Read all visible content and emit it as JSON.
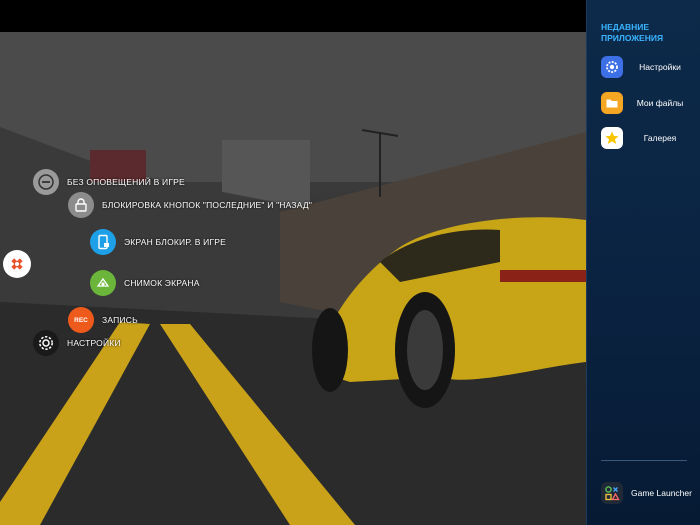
{
  "game_menu": {
    "items": [
      {
        "label": "БЕЗ ОПОВЕЩЕНИЙ В ИГРЕ",
        "icon": "minus-circle-icon"
      },
      {
        "label": "БЛОКИРОВКА КНОПОК \"ПОСЛЕДНИЕ\" И \"НАЗАД\"",
        "icon": "lock-icon"
      },
      {
        "label": "ЭКРАН БЛОКИР. В ИГРЕ",
        "icon": "phone-lock-icon"
      },
      {
        "label": "СНИМОК ЭКРАНА",
        "icon": "screenshot-icon"
      },
      {
        "label": "ЗАПИСЬ",
        "icon": "rec-icon",
        "badge": "REC"
      },
      {
        "label": "НАСТРОЙКИ",
        "icon": "gear-icon"
      }
    ]
  },
  "side_panel": {
    "title": "НЕДАВНИЕ ПРИЛОЖЕНИЯ",
    "apps": [
      {
        "label": "Настройки",
        "icon": "settings-icon",
        "color": "#3d6fe6"
      },
      {
        "label": "Мои файлы",
        "icon": "folder-icon",
        "color": "#f5a623"
      },
      {
        "label": "Галерея",
        "icon": "gallery-icon",
        "color": "#f7c600"
      }
    ],
    "launcher_label": "Game Launcher"
  }
}
